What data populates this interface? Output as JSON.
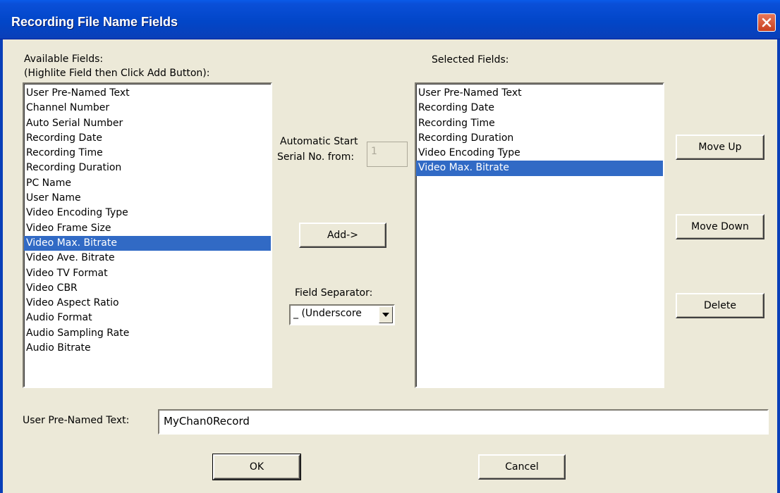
{
  "window": {
    "title": "Recording File Name Fields"
  },
  "available": {
    "label_line1": "Available Fields:",
    "label_line2": "(Highlite Field then Click Add Button):",
    "items": [
      "User Pre-Named Text",
      "Channel Number",
      "Auto Serial Number",
      "Recording Date",
      "Recording Time",
      "Recording Duration",
      "PC Name",
      "User Name",
      "Video Encoding Type",
      "Video Frame Size",
      "Video Max. Bitrate",
      "Video Ave. Bitrate",
      "Video TV Format",
      "Video CBR",
      "Video Aspect Ratio",
      "Audio Format",
      "Audio Sampling Rate",
      "Audio Bitrate"
    ],
    "selected_index": 10
  },
  "serial": {
    "label_line1": "Automatic Start",
    "label_line2": "Serial No. from:",
    "value": "1"
  },
  "add_button": "Add->",
  "separator": {
    "label": "Field Separator:",
    "value": "_ (Underscore"
  },
  "selected": {
    "label": "Selected Fields:",
    "items": [
      "User Pre-Named Text",
      "Recording Date",
      "Recording Time",
      "Recording Duration",
      "Video Encoding Type",
      "Video Max. Bitrate"
    ],
    "selected_index": 5
  },
  "buttons": {
    "move_up": "Move Up",
    "move_down": "Move Down",
    "delete": "Delete",
    "ok": "OK",
    "cancel": "Cancel"
  },
  "prenamed": {
    "label": "User Pre-Named Text:",
    "value": "MyChan0Record"
  },
  "icons": {
    "close": "close-icon",
    "dropdown": "chevron-down-icon"
  }
}
